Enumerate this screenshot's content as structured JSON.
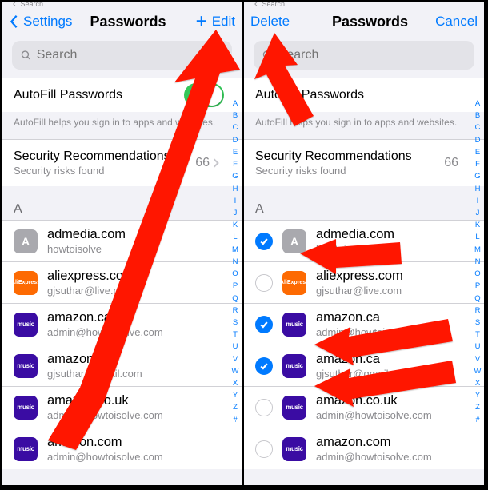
{
  "left": {
    "nav": {
      "back_label": "Settings",
      "title": "Passwords",
      "edit": "Edit"
    },
    "search": {
      "placeholder": "Search"
    },
    "autofill": {
      "title": "AutoFill Passwords",
      "help": "AutoFill helps you sign in to apps and websites."
    },
    "security": {
      "title": "Security Recommendations",
      "sub": "Security risks found",
      "count": "66"
    },
    "section": "A",
    "items": [
      {
        "site": "admedia.com",
        "user": "howtoisolve",
        "icon": "gray",
        "letter": "A"
      },
      {
        "site": "aliexpress.com",
        "user": "gjsuthar@live.com",
        "icon": "orange"
      },
      {
        "site": "amazon.ca",
        "user": "admin@howtoisolve.com",
        "icon": "purple"
      },
      {
        "site": "amazon.ca",
        "user": "gjsuthar@gmail.com",
        "icon": "purple"
      },
      {
        "site": "amazon.co.uk",
        "user": "admin@howtoisolve.com",
        "icon": "purple"
      },
      {
        "site": "amazon.com",
        "user": "admin@howtoisolve.com",
        "icon": "purple"
      }
    ]
  },
  "right": {
    "nav": {
      "delete": "Delete",
      "title": "Passwords",
      "cancel": "Cancel"
    },
    "search": {
      "placeholder": "Search"
    },
    "autofill": {
      "title": "AutoFill Passwords",
      "help": "AutoFill helps you sign in to apps and websites."
    },
    "security": {
      "title": "Security Recommendations",
      "sub": "Security risks found",
      "count": "66"
    },
    "section": "A",
    "items": [
      {
        "site": "admedia.com",
        "user": "howtoisolve",
        "icon": "gray",
        "letter": "A",
        "checked": true
      },
      {
        "site": "aliexpress.com",
        "user": "gjsuthar@live.com",
        "icon": "orange",
        "checked": false
      },
      {
        "site": "amazon.ca",
        "user": "admin@howtoisolve.com",
        "icon": "purple",
        "checked": true
      },
      {
        "site": "amazon.ca",
        "user": "gjsuthar@gmail.com",
        "icon": "purple",
        "checked": true
      },
      {
        "site": "amazon.co.uk",
        "user": "admin@howtoisolve.com",
        "icon": "purple",
        "checked": false
      },
      {
        "site": "amazon.com",
        "user": "admin@howtoisolve.com",
        "icon": "purple",
        "checked": false
      }
    ]
  },
  "index": [
    "A",
    "B",
    "C",
    "D",
    "E",
    "F",
    "G",
    "H",
    "I",
    "J",
    "K",
    "L",
    "M",
    "N",
    "O",
    "P",
    "Q",
    "R",
    "S",
    "T",
    "U",
    "V",
    "W",
    "X",
    "Y",
    "Z",
    "#"
  ]
}
